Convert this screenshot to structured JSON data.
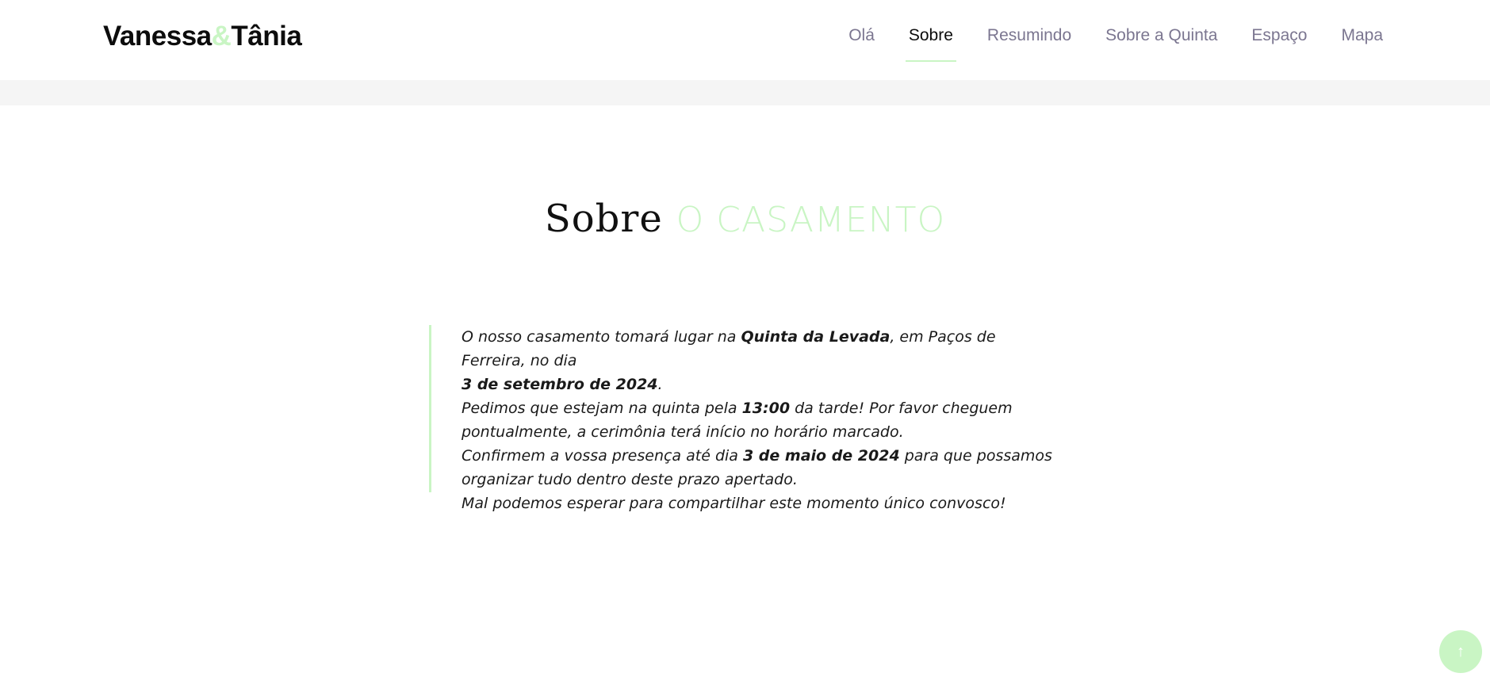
{
  "header": {
    "logo": {
      "first": "Vanessa",
      "amp": "&",
      "second": "Tânia"
    },
    "nav": [
      {
        "label": "Olá",
        "active": false
      },
      {
        "label": "Sobre",
        "active": true
      },
      {
        "label": "Resumindo",
        "active": false
      },
      {
        "label": "Sobre a Quinta",
        "active": false
      },
      {
        "label": "Espaço",
        "active": false
      },
      {
        "label": "Mapa",
        "active": false
      }
    ]
  },
  "section": {
    "title_first": "Sobre",
    "title_second": "o casamento",
    "paragraph": {
      "l1_a": "O nosso casamento tomará lugar na ",
      "l1_b": "Quinta da Levada",
      "l1_c": ", em Paços de Ferreira, no dia",
      "l2_a": "3 de setembro de 2024",
      "l2_b": ".",
      "l3_a": "Pedimos que estejam na quinta pela ",
      "l3_b": "13:00",
      "l3_c": " da tarde! Por favor cheguem",
      "l4": "pontualmente, a cerimônia terá início no horário marcado.",
      "l5_a": "Confirmem a vossa presença até dia ",
      "l5_b": "3 de maio de 2024",
      "l5_c": " para que possamos",
      "l6": "organizar tudo dentro deste prazo apertado.",
      "l7": "Mal podemos esperar para compartilhar este momento único convosco!"
    }
  },
  "back_to_top": {
    "icon": "arrow-up-icon",
    "glyph": "↑"
  },
  "colors": {
    "accent": "#c9f5c4",
    "nav_text": "#7b7690",
    "text": "#0c0c0c",
    "band": "#f5f5f5"
  }
}
